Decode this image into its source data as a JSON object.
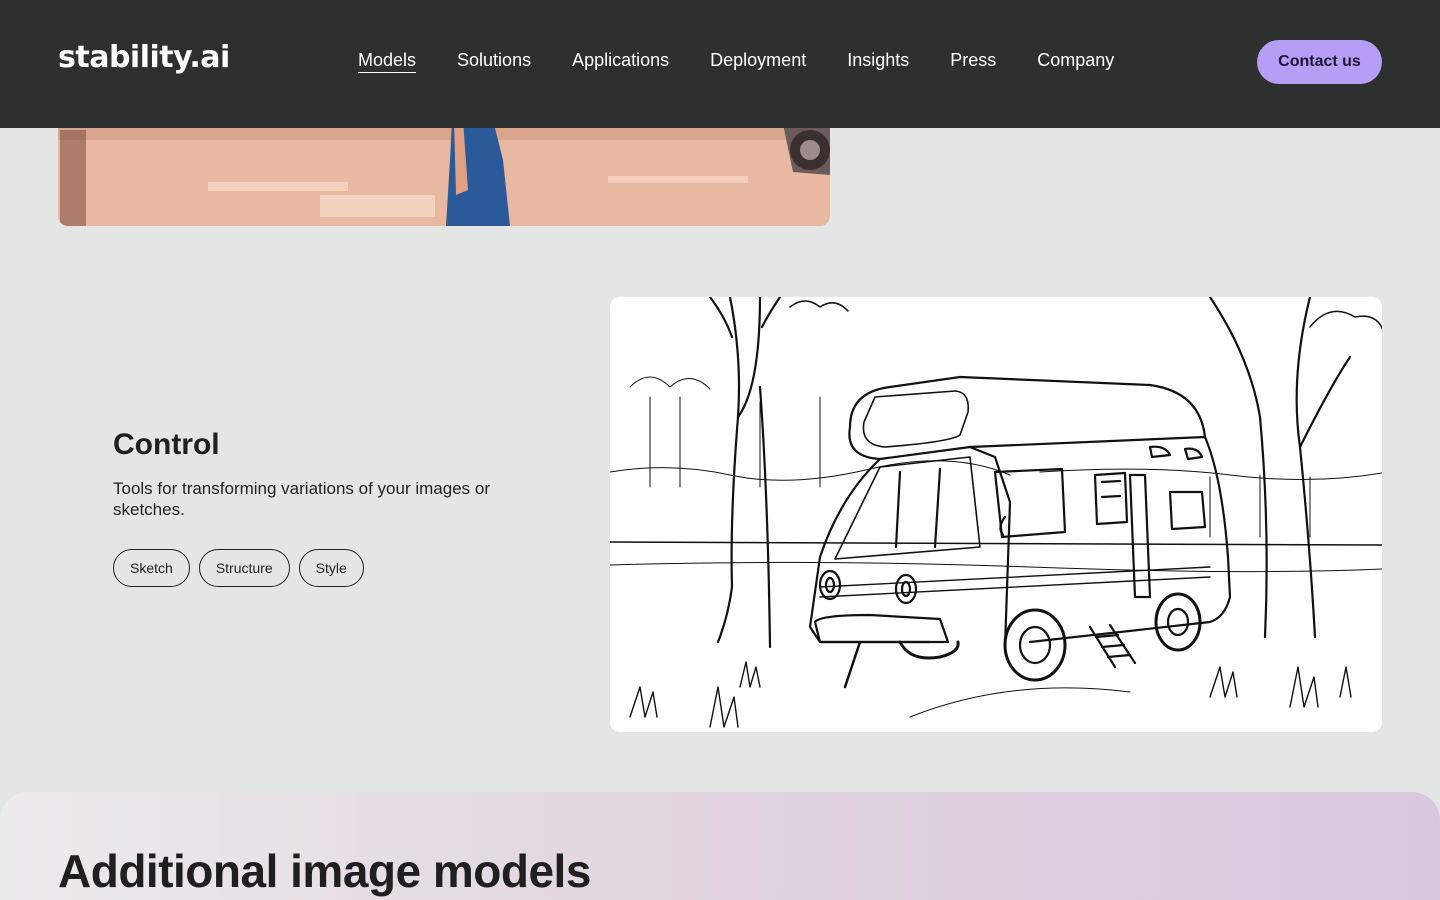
{
  "header": {
    "logo": "stability.ai",
    "nav": [
      {
        "label": "Models",
        "active": true
      },
      {
        "label": "Solutions",
        "active": false
      },
      {
        "label": "Applications",
        "active": false
      },
      {
        "label": "Deployment",
        "active": false
      },
      {
        "label": "Insights",
        "active": false
      },
      {
        "label": "Press",
        "active": false
      },
      {
        "label": "Company",
        "active": false
      }
    ],
    "contact_label": "Contact us"
  },
  "control": {
    "title": "Control",
    "description": "Tools for transforming variations of your images or sketches.",
    "chips": [
      "Sketch",
      "Structure",
      "Style"
    ]
  },
  "additional": {
    "title": "Additional image models"
  },
  "colors": {
    "header_bg": "#2e2f2f",
    "page_bg": "#e4e6e5",
    "accent": "#b69ef7"
  }
}
